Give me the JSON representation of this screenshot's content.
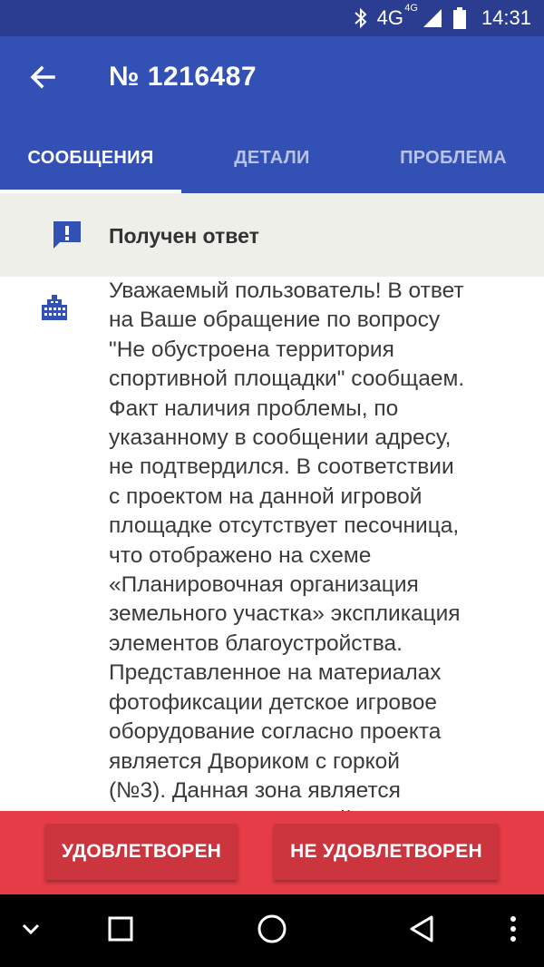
{
  "status_bar": {
    "network": "4G",
    "network_sup": "4G",
    "time": "14:31",
    "icons": [
      "bluetooth-icon",
      "signal-icon",
      "battery-icon"
    ]
  },
  "app_bar": {
    "title": "№ 1216487",
    "back_icon": "arrow-left-icon"
  },
  "tabs": [
    {
      "label": "СООБЩЕНИЯ",
      "active": true
    },
    {
      "label": "ДЕТАЛИ",
      "active": false
    },
    {
      "label": "ПРОБЛЕМА",
      "active": false
    }
  ],
  "status": {
    "icon": "feedback-alert-icon",
    "text": "Получен ответ"
  },
  "message": {
    "icon": "organization-building-icon",
    "text": "Уважаемый пользователь! В ответ\nна Ваше обращение по вопросу\n\"Не обустроена территория\nспортивной площадки\" сообщаем.\nФакт наличия проблемы, по\nуказанному в сообщении адресу,\nне подтвердился. В соответствии\nс проектом на данной игровой\nплощадке отсутствует песочница,\nчто отображено на схеме\n«Планировочная организация\nземельного участка» экспликация\nэлементов благоустройства.\nПредставленное на материалах\nфотофиксации детское игровое\nоборудование согласно проекта\nявляется Двориком с горкой\n(№3). Данная зона является\nманежем для игр детей младшего"
  },
  "actions": {
    "satisfied": "УДОВЛЕТВОРЕН",
    "not_satisfied": "НЕ УДОВЛЕТВОРЕН"
  },
  "colors": {
    "primary": "#3350b4",
    "status_bar": "#2a3d91",
    "action_bar": "#e63c47",
    "action_button": "#cc343e",
    "status_row_bg": "#efefea"
  }
}
